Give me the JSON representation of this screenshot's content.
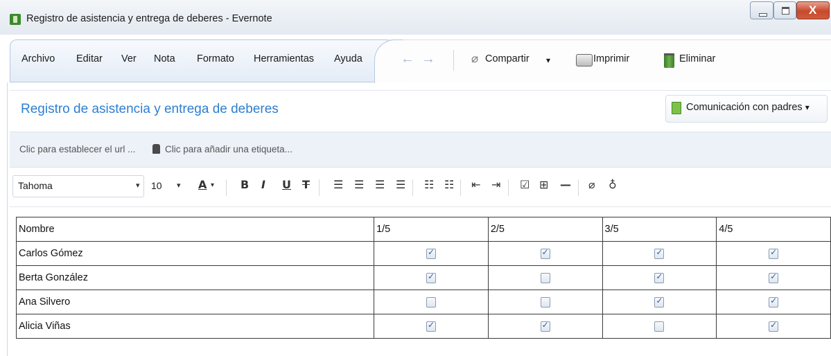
{
  "window": {
    "title": "Registro de asistencia y entrega de deberes - Evernote",
    "close_glyph": "X"
  },
  "menu": [
    "Archivo",
    "Editar",
    "Ver",
    "Nota",
    "Formato",
    "Herramientas",
    "Ayuda"
  ],
  "toolbar": {
    "share_label": "Compartir",
    "share_caret": "▾",
    "print_label": "Imprimir",
    "delete_label": "Eliminar"
  },
  "note": {
    "title": "Registro de asistencia y entrega de deberes",
    "notebook": "Comunicación con padres",
    "notebook_caret": "▾",
    "url_placeholder": "Clic para establecer el url ...",
    "tag_placeholder": "Clic para añadir una etiqueta..."
  },
  "format": {
    "font": "Tahoma",
    "size": "10",
    "caret": "▾"
  },
  "table": {
    "headers": [
      "Nombre",
      "1/5",
      "2/5",
      "3/5",
      "4/5"
    ],
    "rows": [
      {
        "name": "Carlos Gómez",
        "checks": [
          true,
          true,
          true,
          true
        ]
      },
      {
        "name": "Berta González",
        "checks": [
          true,
          false,
          true,
          true
        ]
      },
      {
        "name": "Ana Silvero",
        "checks": [
          false,
          false,
          true,
          true
        ]
      },
      {
        "name": "Alicia Viñas",
        "checks": [
          true,
          true,
          false,
          true
        ]
      }
    ]
  },
  "icons": {
    "back": "back-arrow-icon",
    "forward": "forward-arrow-icon",
    "share": "paperclip-icon",
    "print": "printer-icon",
    "delete": "trash-icon",
    "notebook": "notebook-icon",
    "tag": "tag-icon"
  },
  "colors": {
    "title_blue": "#2d7fcf",
    "close_red": "#c6492d",
    "check_blue": "#2b5fa8"
  }
}
